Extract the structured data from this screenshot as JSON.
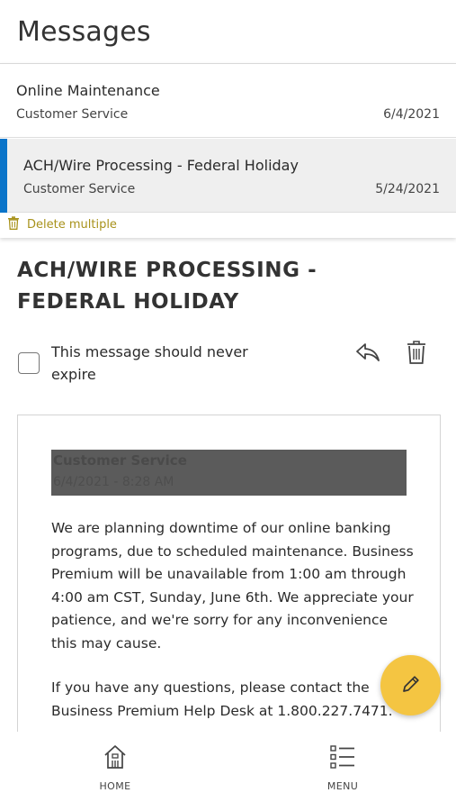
{
  "header": {
    "title": "Messages"
  },
  "messages": [
    {
      "subject": "Online Maintenance",
      "sender": "Customer Service",
      "date": "6/4/2021"
    },
    {
      "subject": "ACH/Wire Processing - Federal Holiday",
      "sender": "Customer Service",
      "date": "5/24/2021"
    }
  ],
  "selected_index": 1,
  "delete_multiple": {
    "label": "Delete multiple",
    "icon": "trash-icon"
  },
  "detail": {
    "title": "ACH/WIRE PROCESSING - FEDERAL HOLIDAY",
    "never_expire_label": "This message should never expire",
    "never_expire_checked": false,
    "reply_icon": "reply-icon",
    "delete_icon": "trash-icon",
    "sender": "Customer Service",
    "timestamp": "6/4/2021 - 8:28 AM",
    "paragraphs": [
      "We are planning downtime of our online banking programs, due to scheduled maintenance. Business Premium will be unavailable from 1:00 am through 4:00 am CST, Sunday, June 6th. We appreciate your patience, and we're sorry for any inconvenience this may cause.",
      "If you have any questions, please contact the Business Premium Help Desk at 1.800.227.7471."
    ]
  },
  "compose": {
    "icon": "pencil-icon",
    "color": "#f4c542"
  },
  "nav": {
    "home": {
      "label": "HOME",
      "icon": "bank-icon"
    },
    "menu": {
      "label": "MENU",
      "icon": "menu-list-icon"
    }
  },
  "colors": {
    "accent": "#0a74c9",
    "delete_multiple": "#a8921b",
    "fab": "#f4c542"
  }
}
